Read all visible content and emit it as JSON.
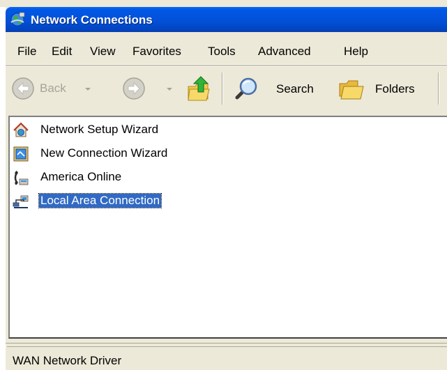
{
  "window": {
    "title": "Network Connections",
    "title_icon": "network-globe-icon"
  },
  "menu": {
    "items": [
      "File",
      "Edit",
      "View",
      "Favorites",
      "Tools",
      "Advanced",
      "Help"
    ]
  },
  "toolbar": {
    "back_label": "Back",
    "search_label": "Search",
    "folders_label": "Folders",
    "back_icon": "back-arrow-icon",
    "forward_icon": "forward-arrow-icon",
    "up_icon": "folder-up-icon",
    "search_icon": "magnifier-icon",
    "folders_icon": "folders-icon"
  },
  "items": [
    {
      "label": "Network Setup Wizard",
      "icon": "network-setup-wizard-icon",
      "selected": false
    },
    {
      "label": "New Connection Wizard",
      "icon": "new-connection-wizard-icon",
      "selected": false
    },
    {
      "label": "America Online",
      "icon": "dialup-phone-icon",
      "selected": false
    },
    {
      "label": "Local Area Connection",
      "icon": "lan-connection-icon",
      "selected": true
    }
  ],
  "status": {
    "text": "WAN Network Driver"
  },
  "colors": {
    "title_bar": "#0350d8",
    "selection": "#316ac5",
    "chrome": "#ece9d8"
  }
}
